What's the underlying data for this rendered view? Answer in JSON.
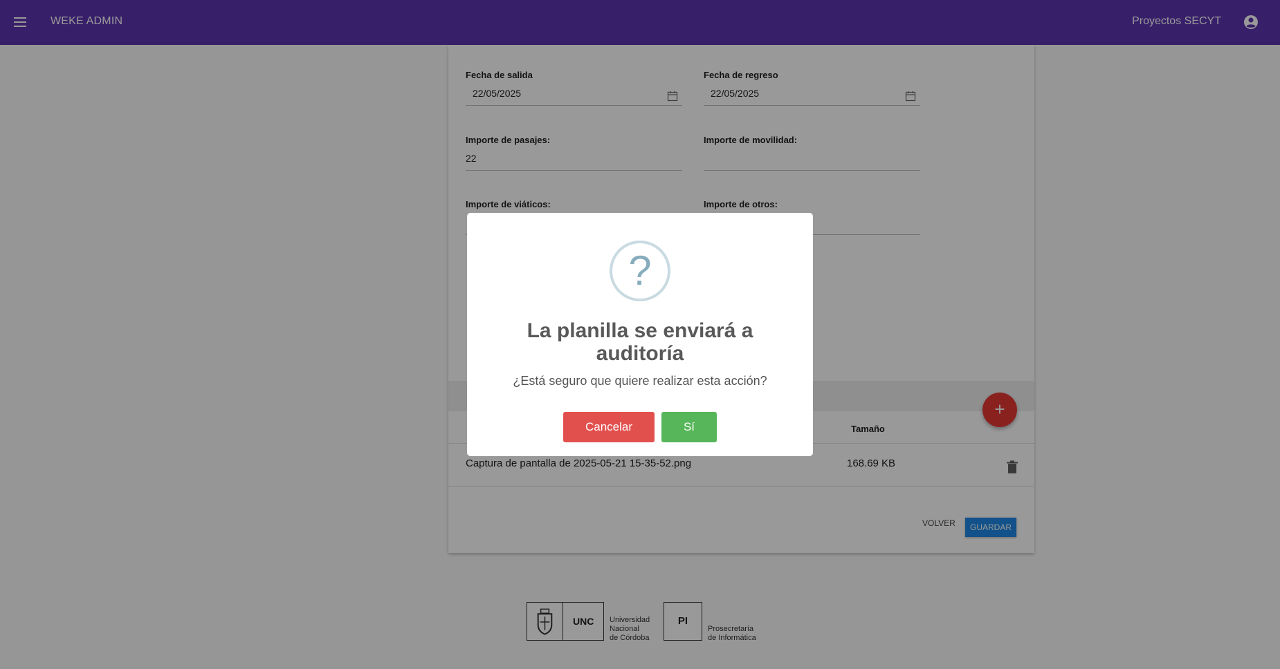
{
  "topbar": {
    "app_title": "WEKE ADMIN",
    "project_title": "Proyectos SECYT",
    "menu_icon": "menu-icon",
    "account_icon": "account-circle-icon",
    "color": "#5e35b1"
  },
  "form": {
    "fecha_salida": {
      "label": "Fecha de salida",
      "value": "22/05/2025"
    },
    "fecha_regreso": {
      "label": "Fecha de regreso",
      "value": "22/05/2025"
    },
    "importe_pasajes": {
      "label": "Importe de pasajes:",
      "value": "22"
    },
    "importe_movilidad": {
      "label": "Importe de movilidad:",
      "value": ""
    },
    "importe_viaticos": {
      "label": "Importe de viáticos:",
      "value": ""
    },
    "importe_otros": {
      "label": "Importe de otros:",
      "value": ""
    }
  },
  "files": {
    "columns": {
      "size": "Tamaño"
    },
    "rows": [
      {
        "name": "Captura de pantalla de 2025-05-21 15-35-52.png",
        "size": "168.69 KB"
      }
    ],
    "add_icon": "+"
  },
  "actions": {
    "back_label": "VOLVER",
    "save_label": "GUARDAR"
  },
  "footer": {
    "unc_abbr": "UNC",
    "unc_name": [
      "Universidad",
      "Nacional",
      "de Córdoba"
    ],
    "pi_abbr": "PI",
    "pi_name": [
      "Prosecretaría",
      "de Informática"
    ]
  },
  "modal": {
    "icon": "?",
    "title": "La planilla se enviará a auditoría",
    "text": "¿Está seguro que quiere realizar esta acción?",
    "cancel_label": "Cancelar",
    "confirm_label": "Sí",
    "cancel_color": "#e2504e",
    "confirm_color": "#57b659"
  }
}
